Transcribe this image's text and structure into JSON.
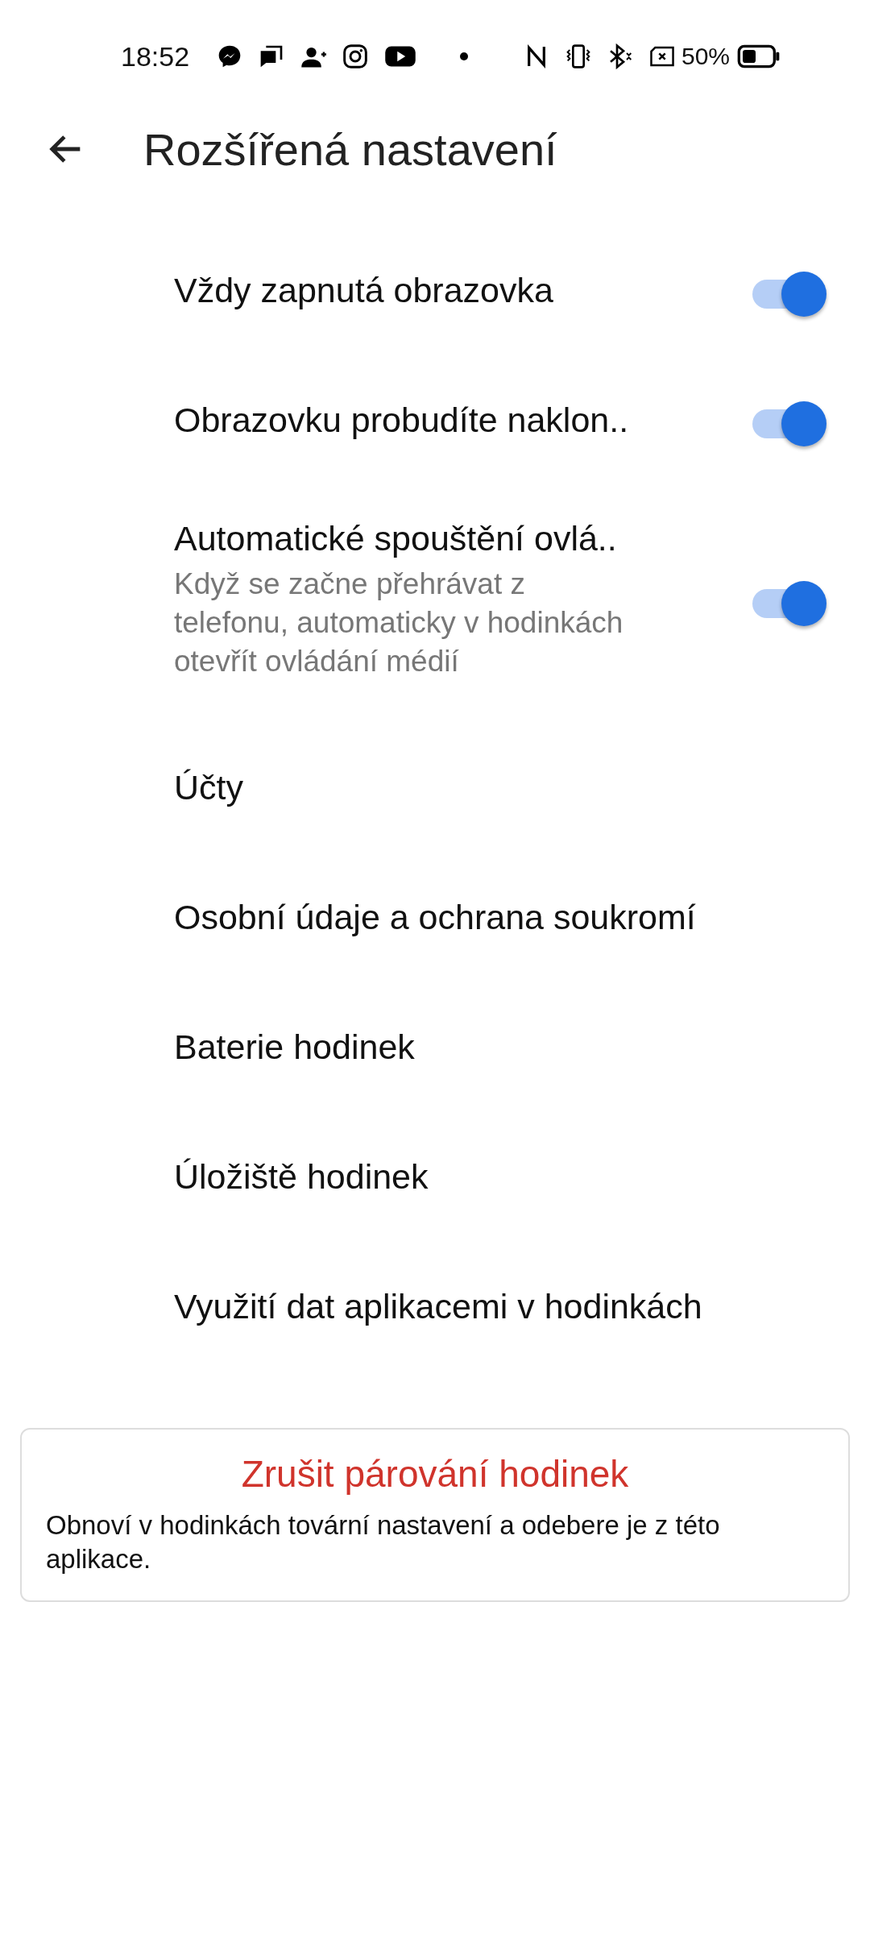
{
  "status_bar": {
    "time": "18:52",
    "battery": "50%"
  },
  "header": {
    "title": "Rozšířená nastavení"
  },
  "items": [
    {
      "kind": "toggle",
      "title": "Vždy zapnutá obrazovka",
      "on": true
    },
    {
      "kind": "toggle",
      "title": "Obrazovku probudíte naklon..",
      "on": true
    },
    {
      "kind": "toggle",
      "title": "Automatické spouštění ovlá..",
      "subtitle": "Když se začne přehrávat z telefonu, automaticky v hodinkách otevřít ovládání médií",
      "on": true
    },
    {
      "kind": "link",
      "title": "Účty"
    },
    {
      "kind": "link",
      "title": "Osobní údaje a ochrana soukromí"
    },
    {
      "kind": "link",
      "title": "Baterie hodinek"
    },
    {
      "kind": "link",
      "title": "Úložiště hodinek"
    },
    {
      "kind": "link",
      "title": "Využití dat aplikacemi v hodinkách"
    }
  ],
  "unpair_card": {
    "action": "Zrušit párování hodinek",
    "description": "Obnoví v hodinkách tovární nastavení a odebere je z této aplikace."
  }
}
